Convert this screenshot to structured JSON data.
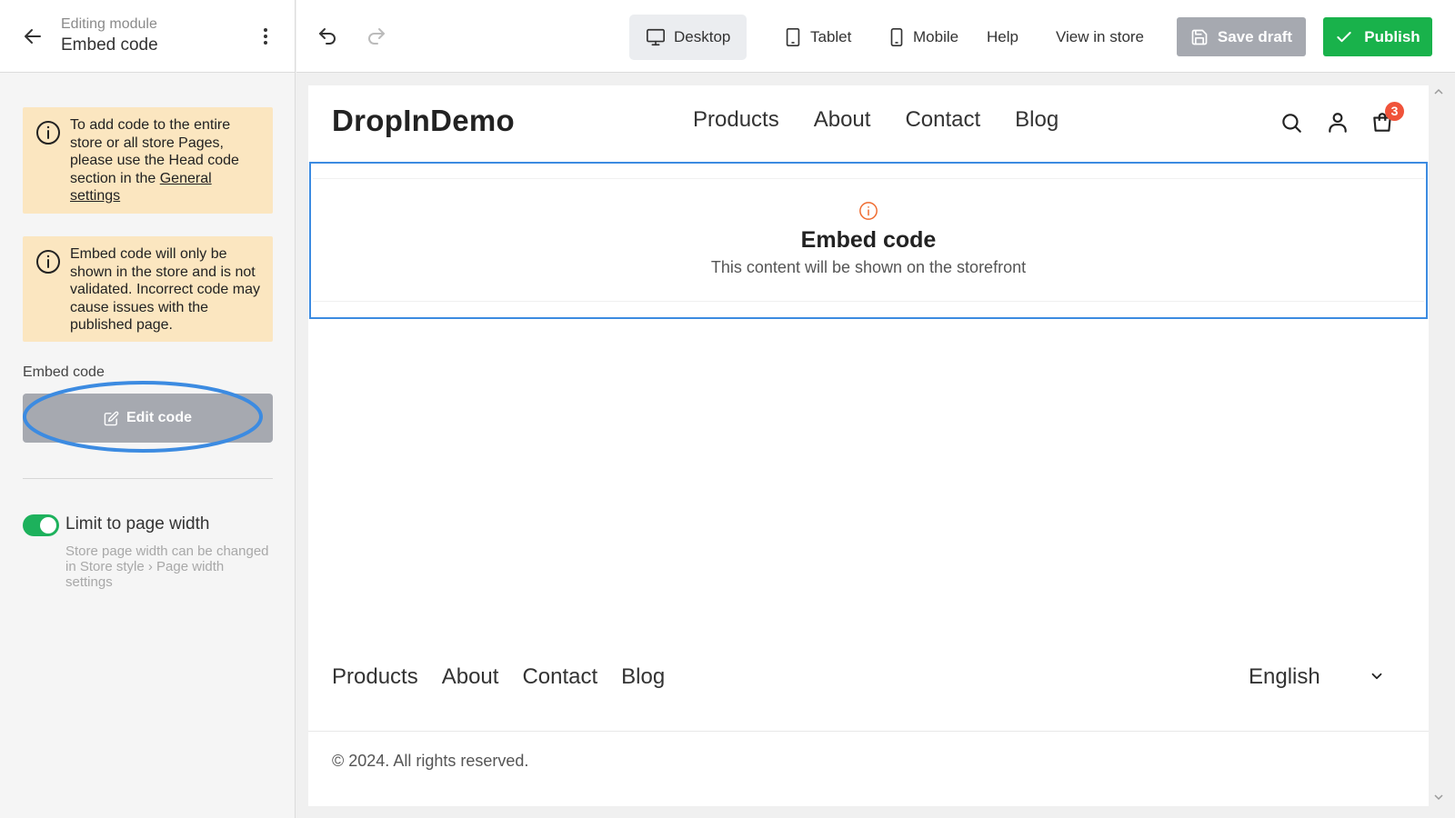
{
  "left_panel": {
    "subtitle": "Editing module",
    "title": "Embed code",
    "notices": [
      {
        "text_before": "To add code to the entire store or all store Pages, please use the Head code section in the ",
        "link": "General settings",
        "text_after": ""
      },
      {
        "text_before": "Embed code will only be shown in the store and is not validated. Incorrect code may cause issues with the published page.",
        "link": "",
        "text_after": ""
      }
    ],
    "field_label": "Embed code",
    "edit_button": "Edit code",
    "toggle": {
      "label": "Limit to page width",
      "on": true,
      "hint": "Store page width can be changed in Store style › Page width settings"
    }
  },
  "toolbar": {
    "tabs": [
      {
        "label": "Desktop",
        "active": true
      },
      {
        "label": "Tablet",
        "active": false
      },
      {
        "label": "Mobile",
        "active": false
      }
    ],
    "help": "Help",
    "view_in_store": "View in store",
    "save_draft": "Save draft",
    "publish": "Publish"
  },
  "preview": {
    "logo": "DropInDemo",
    "nav": [
      "Products",
      "About",
      "Contact",
      "Blog"
    ],
    "cart_count": "3",
    "embed": {
      "title": "Embed code",
      "subtitle": "This content will be shown on the storefront"
    },
    "footer_nav": [
      "Products",
      "About",
      "Contact",
      "Blog"
    ],
    "language": "English",
    "copyright": "© 2024. All rights reserved."
  },
  "colors": {
    "publish": "#19b24b",
    "disabled_button": "#a6a9b0",
    "notice_bg": "#fbe6c0",
    "selection_border": "#3c8be1",
    "toggle_on": "#1db15c",
    "badge": "#f0533a",
    "embed_info_icon": "#ef6a2e"
  },
  "icons": [
    "arrow-left-icon",
    "kebab-menu-icon",
    "info-icon",
    "edit-icon",
    "undo-icon",
    "redo-icon",
    "desktop-icon",
    "tablet-icon",
    "mobile-icon",
    "save-icon",
    "checkmark-icon",
    "search-icon",
    "user-icon",
    "cart-icon",
    "chevron-down-icon"
  ]
}
